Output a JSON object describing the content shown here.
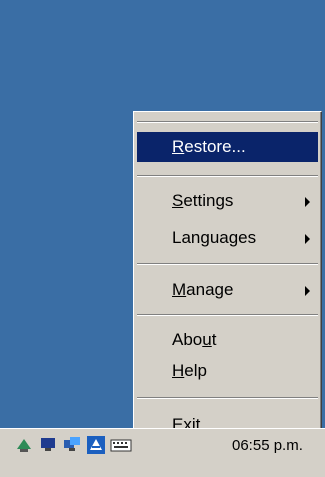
{
  "menu": {
    "items": [
      {
        "pre": "",
        "key": "R",
        "post": "estore...",
        "selected": true
      },
      {
        "pre": "",
        "key": "S",
        "post": "ettings"
      },
      {
        "pre": "",
        "key": "",
        "post": "Languages"
      },
      {
        "pre": "",
        "key": "M",
        "post": "anage"
      },
      {
        "pre": "Abo",
        "key": "u",
        "post": "t"
      },
      {
        "pre": "",
        "key": "H",
        "post": "elp"
      },
      {
        "pre": "E",
        "key": "x",
        "post": "it"
      }
    ]
  },
  "taskbar": {
    "clock": "06:55 p.m.",
    "tray_icons": [
      "network-icon",
      "monitor-icon",
      "network-monitor-icon",
      "app-icon",
      "keyboard-icon"
    ]
  },
  "colors": {
    "desktop": "#3a6ea5",
    "menu_bg": "#d4d0c8",
    "selection": "#0a246a"
  }
}
